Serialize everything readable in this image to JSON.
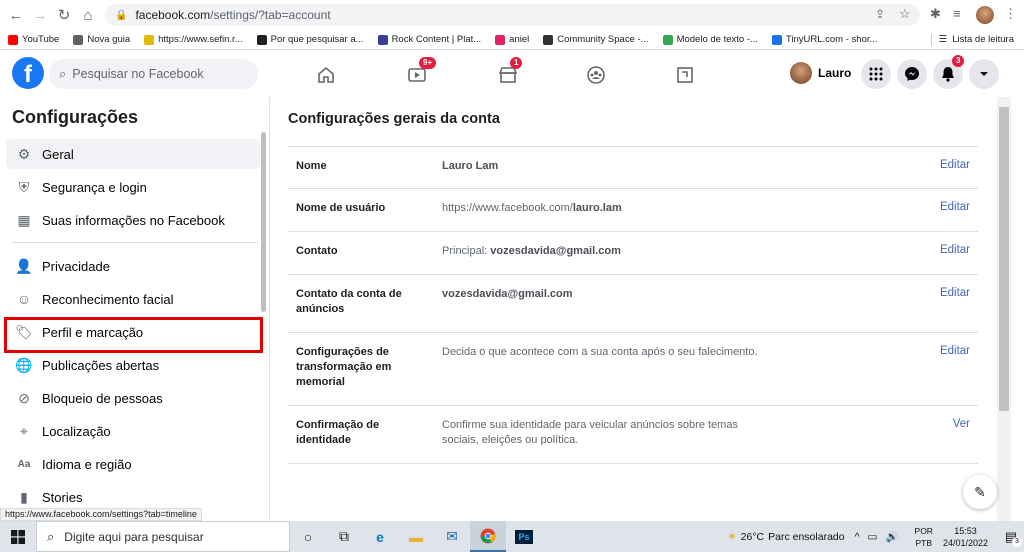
{
  "browser": {
    "url_host": "facebook.com",
    "url_path": "/settings/?tab=account",
    "bookmarks": [
      {
        "label": "YouTube",
        "color": "#ff0000"
      },
      {
        "label": "Nova guia",
        "color": "#5f6368"
      },
      {
        "label": "https://www.sefin.r...",
        "color": "#e6b800"
      },
      {
        "label": "Por que pesquisar a...",
        "color": "#222222"
      },
      {
        "label": "Rock Content | Plat...",
        "color": "#3b3f8f"
      },
      {
        "label": "aniel",
        "color": "#e0245e"
      },
      {
        "label": "Community Space -...",
        "color": "#333333"
      },
      {
        "label": "Modelo de texto -...",
        "color": "#34a853"
      },
      {
        "label": "TinyURL.com - shor...",
        "color": "#1a73e8"
      }
    ],
    "reading_list": "Lista de leitura",
    "status_url": "https://www.facebook.com/settings?tab=timeline"
  },
  "fb_header": {
    "search_placeholder": "Pesquisar no Facebook",
    "watch_badge": "9+",
    "marketplace_badge": "1",
    "profile_name": "Lauro",
    "notifications_badge": "3",
    "brand_color": "#1877f2"
  },
  "sidebar": {
    "title": "Configurações",
    "items": [
      {
        "label": "Geral",
        "icon": "gear-icon"
      },
      {
        "label": "Segurança e login",
        "icon": "shield-icon"
      },
      {
        "label": "Suas informações no Facebook",
        "icon": "info-grid-icon"
      },
      {
        "label": "Privacidade",
        "icon": "person-lock-icon"
      },
      {
        "label": "Reconhecimento facial",
        "icon": "face-scan-icon"
      },
      {
        "label": "Perfil e marcação",
        "icon": "tag-icon"
      },
      {
        "label": "Publicações abertas",
        "icon": "globe-icon"
      },
      {
        "label": "Bloqueio de pessoas",
        "icon": "block-user-icon"
      },
      {
        "label": "Localização",
        "icon": "location-pin-icon"
      },
      {
        "label": "Idioma e região",
        "icon": "language-icon"
      },
      {
        "label": "Stories",
        "icon": "stories-icon"
      }
    ]
  },
  "main": {
    "title": "Configurações gerais da conta",
    "rows": [
      {
        "label": "Nome",
        "value_bold": "Lauro Lam",
        "action": "Editar"
      },
      {
        "label": "Nome de usuário",
        "value_prefix": "https://www.facebook.com/",
        "value_bold": "lauro.lam",
        "action": "Editar"
      },
      {
        "label": "Contato",
        "value_prefix": "Principal: ",
        "value_bold": "vozesdavida@gmail.com",
        "action": "Editar"
      },
      {
        "label": "Contato da conta de anúncios",
        "value_bold": "vozesdavida@gmail.com",
        "action": "Editar"
      },
      {
        "label": "Configurações de transformação em memorial",
        "value_prefix": "Decida o que acontece com a sua conta após o seu falecimento.",
        "action": "Editar"
      },
      {
        "label": "Confirmação de identidade",
        "value_prefix": "Confirme sua identidade para veicular anúncios sobre temas sociais, eleições ou política.",
        "action": "Ver"
      }
    ]
  },
  "taskbar": {
    "search_placeholder": "Digite aqui para pesquisar",
    "temperature": "26°C",
    "weather_text": "Parc ensolarado",
    "lang_1": "POR",
    "lang_2": "PTB",
    "time": "15:53",
    "date": "24/01/2022",
    "notification_count": "3"
  }
}
